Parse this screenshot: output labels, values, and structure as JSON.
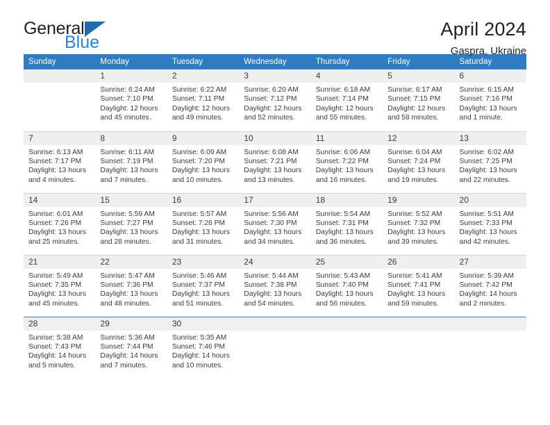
{
  "brand": {
    "name_top": "General",
    "name_bottom": "Blue",
    "flag_color": "#1f6cb0",
    "blue_color": "#2a84cf"
  },
  "header": {
    "title": "April 2024",
    "location": "Gaspra, Ukraine"
  },
  "theme": {
    "header_blue": "#2f7dc0",
    "daynum_band": "#efefef",
    "row_divider": "#d4d4d4"
  },
  "weekday_headers": [
    "Sunday",
    "Monday",
    "Tuesday",
    "Wednesday",
    "Thursday",
    "Friday",
    "Saturday"
  ],
  "weeks": [
    [
      {
        "day": ""
      },
      {
        "day": "1",
        "sunrise": "Sunrise: 6:24 AM",
        "sunset": "Sunset: 7:10 PM",
        "daylight1": "Daylight: 12 hours",
        "daylight2": "and 45 minutes."
      },
      {
        "day": "2",
        "sunrise": "Sunrise: 6:22 AM",
        "sunset": "Sunset: 7:11 PM",
        "daylight1": "Daylight: 12 hours",
        "daylight2": "and 49 minutes."
      },
      {
        "day": "3",
        "sunrise": "Sunrise: 6:20 AM",
        "sunset": "Sunset: 7:12 PM",
        "daylight1": "Daylight: 12 hours",
        "daylight2": "and 52 minutes."
      },
      {
        "day": "4",
        "sunrise": "Sunrise: 6:18 AM",
        "sunset": "Sunset: 7:14 PM",
        "daylight1": "Daylight: 12 hours",
        "daylight2": "and 55 minutes."
      },
      {
        "day": "5",
        "sunrise": "Sunrise: 6:17 AM",
        "sunset": "Sunset: 7:15 PM",
        "daylight1": "Daylight: 12 hours",
        "daylight2": "and 58 minutes."
      },
      {
        "day": "6",
        "sunrise": "Sunrise: 6:15 AM",
        "sunset": "Sunset: 7:16 PM",
        "daylight1": "Daylight: 13 hours",
        "daylight2": "and 1 minute."
      }
    ],
    [
      {
        "day": "7",
        "sunrise": "Sunrise: 6:13 AM",
        "sunset": "Sunset: 7:17 PM",
        "daylight1": "Daylight: 13 hours",
        "daylight2": "and 4 minutes."
      },
      {
        "day": "8",
        "sunrise": "Sunrise: 6:11 AM",
        "sunset": "Sunset: 7:19 PM",
        "daylight1": "Daylight: 13 hours",
        "daylight2": "and 7 minutes."
      },
      {
        "day": "9",
        "sunrise": "Sunrise: 6:09 AM",
        "sunset": "Sunset: 7:20 PM",
        "daylight1": "Daylight: 13 hours",
        "daylight2": "and 10 minutes."
      },
      {
        "day": "10",
        "sunrise": "Sunrise: 6:08 AM",
        "sunset": "Sunset: 7:21 PM",
        "daylight1": "Daylight: 13 hours",
        "daylight2": "and 13 minutes."
      },
      {
        "day": "11",
        "sunrise": "Sunrise: 6:06 AM",
        "sunset": "Sunset: 7:22 PM",
        "daylight1": "Daylight: 13 hours",
        "daylight2": "and 16 minutes."
      },
      {
        "day": "12",
        "sunrise": "Sunrise: 6:04 AM",
        "sunset": "Sunset: 7:24 PM",
        "daylight1": "Daylight: 13 hours",
        "daylight2": "and 19 minutes."
      },
      {
        "day": "13",
        "sunrise": "Sunrise: 6:02 AM",
        "sunset": "Sunset: 7:25 PM",
        "daylight1": "Daylight: 13 hours",
        "daylight2": "and 22 minutes."
      }
    ],
    [
      {
        "day": "14",
        "sunrise": "Sunrise: 6:01 AM",
        "sunset": "Sunset: 7:26 PM",
        "daylight1": "Daylight: 13 hours",
        "daylight2": "and 25 minutes."
      },
      {
        "day": "15",
        "sunrise": "Sunrise: 5:59 AM",
        "sunset": "Sunset: 7:27 PM",
        "daylight1": "Daylight: 13 hours",
        "daylight2": "and 28 minutes."
      },
      {
        "day": "16",
        "sunrise": "Sunrise: 5:57 AM",
        "sunset": "Sunset: 7:28 PM",
        "daylight1": "Daylight: 13 hours",
        "daylight2": "and 31 minutes."
      },
      {
        "day": "17",
        "sunrise": "Sunrise: 5:56 AM",
        "sunset": "Sunset: 7:30 PM",
        "daylight1": "Daylight: 13 hours",
        "daylight2": "and 34 minutes."
      },
      {
        "day": "18",
        "sunrise": "Sunrise: 5:54 AM",
        "sunset": "Sunset: 7:31 PM",
        "daylight1": "Daylight: 13 hours",
        "daylight2": "and 36 minutes."
      },
      {
        "day": "19",
        "sunrise": "Sunrise: 5:52 AM",
        "sunset": "Sunset: 7:32 PM",
        "daylight1": "Daylight: 13 hours",
        "daylight2": "and 39 minutes."
      },
      {
        "day": "20",
        "sunrise": "Sunrise: 5:51 AM",
        "sunset": "Sunset: 7:33 PM",
        "daylight1": "Daylight: 13 hours",
        "daylight2": "and 42 minutes."
      }
    ],
    [
      {
        "day": "21",
        "sunrise": "Sunrise: 5:49 AM",
        "sunset": "Sunset: 7:35 PM",
        "daylight1": "Daylight: 13 hours",
        "daylight2": "and 45 minutes."
      },
      {
        "day": "22",
        "sunrise": "Sunrise: 5:47 AM",
        "sunset": "Sunset: 7:36 PM",
        "daylight1": "Daylight: 13 hours",
        "daylight2": "and 48 minutes."
      },
      {
        "day": "23",
        "sunrise": "Sunrise: 5:46 AM",
        "sunset": "Sunset: 7:37 PM",
        "daylight1": "Daylight: 13 hours",
        "daylight2": "and 51 minutes."
      },
      {
        "day": "24",
        "sunrise": "Sunrise: 5:44 AM",
        "sunset": "Sunset: 7:38 PM",
        "daylight1": "Daylight: 13 hours",
        "daylight2": "and 54 minutes."
      },
      {
        "day": "25",
        "sunrise": "Sunrise: 5:43 AM",
        "sunset": "Sunset: 7:40 PM",
        "daylight1": "Daylight: 13 hours",
        "daylight2": "and 56 minutes."
      },
      {
        "day": "26",
        "sunrise": "Sunrise: 5:41 AM",
        "sunset": "Sunset: 7:41 PM",
        "daylight1": "Daylight: 13 hours",
        "daylight2": "and 59 minutes."
      },
      {
        "day": "27",
        "sunrise": "Sunrise: 5:39 AM",
        "sunset": "Sunset: 7:42 PM",
        "daylight1": "Daylight: 14 hours",
        "daylight2": "and 2 minutes."
      }
    ],
    [
      {
        "day": "28",
        "sunrise": "Sunrise: 5:38 AM",
        "sunset": "Sunset: 7:43 PM",
        "daylight1": "Daylight: 14 hours",
        "daylight2": "and 5 minutes."
      },
      {
        "day": "29",
        "sunrise": "Sunrise: 5:36 AM",
        "sunset": "Sunset: 7:44 PM",
        "daylight1": "Daylight: 14 hours",
        "daylight2": "and 7 minutes."
      },
      {
        "day": "30",
        "sunrise": "Sunrise: 5:35 AM",
        "sunset": "Sunset: 7:46 PM",
        "daylight1": "Daylight: 14 hours",
        "daylight2": "and 10 minutes."
      },
      {
        "day": ""
      },
      {
        "day": ""
      },
      {
        "day": ""
      },
      {
        "day": ""
      }
    ]
  ]
}
